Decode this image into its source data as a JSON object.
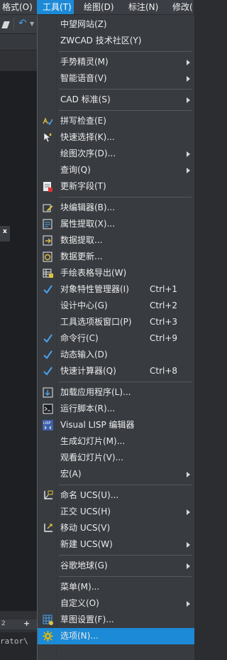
{
  "menubar": {
    "items": [
      "格式(O)",
      "工具(T)",
      "绘图(D)",
      "标注(N)",
      "修改("
    ],
    "active_index": 1
  },
  "background": {
    "status_text": "2",
    "plus_label": "+",
    "close_label": "x",
    "command_text": "rator\\"
  },
  "menu": {
    "items": [
      {
        "label": "中望网站(Z)",
        "icon": "none"
      },
      {
        "label": "ZWCAD 技术社区(Y)",
        "icon": "none"
      },
      {
        "sep": true
      },
      {
        "label": "手势精灵(M)",
        "icon": "none",
        "submenu": true
      },
      {
        "label": "智能语音(V)",
        "icon": "none",
        "submenu": true
      },
      {
        "sep": true
      },
      {
        "label": "CAD 标准(S)",
        "icon": "none",
        "submenu": true
      },
      {
        "sep": true
      },
      {
        "label": "拼写检查(E)",
        "icon": "spellcheck-icon"
      },
      {
        "label": "快速选择(K)...",
        "icon": "quick-select-icon"
      },
      {
        "label": "绘图次序(D)...",
        "icon": "none",
        "submenu": true
      },
      {
        "label": "查询(Q)",
        "icon": "none",
        "submenu": true
      },
      {
        "label": "更新字段(T)",
        "icon": "update-field-icon"
      },
      {
        "sep": true
      },
      {
        "label": "块编辑器(B)...",
        "icon": "block-editor-icon"
      },
      {
        "label": "属性提取(X)...",
        "icon": "attribute-extract-icon"
      },
      {
        "label": "数据提取...",
        "icon": "data-extract-icon"
      },
      {
        "label": "数据更新...",
        "icon": "data-update-icon"
      },
      {
        "label": "手绘表格导出(W)",
        "icon": "table-export-icon"
      },
      {
        "label": "对象特性管理器(I)",
        "icon": "check-icon",
        "shortcut": "Ctrl+1"
      },
      {
        "label": "设计中心(G)",
        "icon": "none",
        "shortcut": "Ctrl+2"
      },
      {
        "label": "工具选项板窗口(P)",
        "icon": "none",
        "shortcut": "Ctrl+3"
      },
      {
        "label": "命令行(C)",
        "icon": "check-icon",
        "shortcut": "Ctrl+9"
      },
      {
        "label": "动态输入(D)",
        "icon": "check-icon"
      },
      {
        "label": "快速计算器(Q)",
        "icon": "check-icon",
        "shortcut": "Ctrl+8"
      },
      {
        "sep": true
      },
      {
        "label": "加载应用程序(L)...",
        "icon": "load-app-icon"
      },
      {
        "label": "运行脚本(R)...",
        "icon": "run-script-icon"
      },
      {
        "label": "Visual LISP 编辑器",
        "icon": "lisp-icon"
      },
      {
        "label": "生成幻灯片(M)...",
        "icon": "none"
      },
      {
        "label": "观看幻灯片(V)...",
        "icon": "none"
      },
      {
        "label": "宏(A)",
        "icon": "none",
        "submenu": true
      },
      {
        "sep": true
      },
      {
        "label": "命名 UCS(U)...",
        "icon": "named-ucs-icon"
      },
      {
        "label": "正交 UCS(H)",
        "icon": "none",
        "submenu": true
      },
      {
        "label": "移动 UCS(V)",
        "icon": "move-ucs-icon"
      },
      {
        "label": "新建 UCS(W)",
        "icon": "none",
        "submenu": true
      },
      {
        "sep": true
      },
      {
        "label": "谷歌地球(G)",
        "icon": "none",
        "submenu": true
      },
      {
        "sep": true
      },
      {
        "label": "菜单(M)...",
        "icon": "none"
      },
      {
        "label": "自定义(O)",
        "icon": "none",
        "submenu": true
      },
      {
        "label": "草图设置(F)...",
        "icon": "drafting-settings-icon"
      },
      {
        "label": "选项(N)...",
        "icon": "gear-icon",
        "selected": true
      }
    ]
  }
}
